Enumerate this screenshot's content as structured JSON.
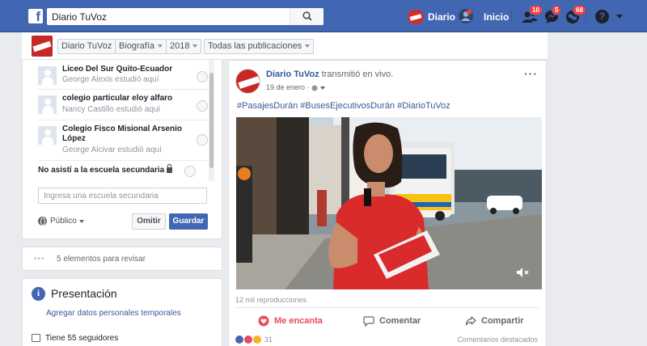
{
  "topbar": {
    "logo": "f",
    "search_value": "Diario TuVoz",
    "page_label": "Diario",
    "home_label": "Inicio",
    "friend_badge": "10",
    "message_badge": "5",
    "notif_badge": "68",
    "help": "?"
  },
  "subheader": {
    "page_name": "Diario TuVoz",
    "section": "Biografía",
    "year": "2018",
    "filter": "Todas las publicaciones"
  },
  "schools": [
    {
      "name": "Liceo Del Sur Quito-Ecuador",
      "sub": "George Alexis estudió aquí"
    },
    {
      "name": "colegio particular eloy alfaro",
      "sub": "Nancy Castillo estudió aquí"
    },
    {
      "name": "Colegio Fisco Misional Arsenio López",
      "sub": "George Alcivar estudió aquí"
    }
  ],
  "no_school": "No asistí a la escuela secundaria",
  "school_input_placeholder": "Ingresa una escuela secundaria",
  "privacy": "Público",
  "skip_btn": "Omitir",
  "save_btn": "Guardar",
  "review": {
    "dots": "•••",
    "text": "5 elementos para revisar"
  },
  "presentation": {
    "icon": "i",
    "title": "Presentación",
    "link": "Agregar datos personales temporales",
    "followers": "Tiene 55 seguidores"
  },
  "post": {
    "author": "Diario TuVoz",
    "action": "transmitió en vivo.",
    "date": "19 de enero · ",
    "more": "···",
    "hashtags": "#PasajesDurán #BusesEjecutivosDurán #DiarioTuVoz",
    "views": "12 mil reproducciones",
    "love": "Me encanta",
    "comment": "Comentar",
    "share": "Compartir",
    "reaction_count": "31",
    "comments_label": "Comentarios destacados"
  },
  "colors": {
    "brand": "#4267b2",
    "love": "#e74c5c",
    "link": "#365899"
  }
}
